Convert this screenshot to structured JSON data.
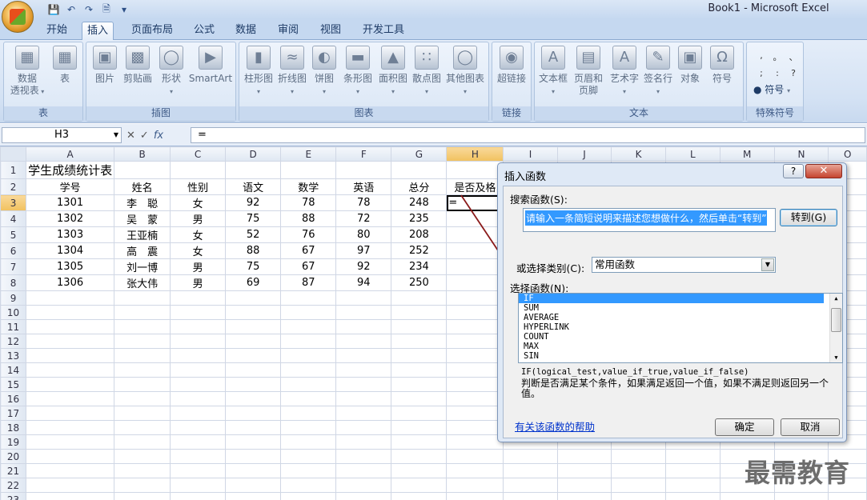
{
  "titlebar": {
    "window_title": "Book1 - Microsoft Excel"
  },
  "tabs": [
    {
      "label": "开始"
    },
    {
      "label": "插入"
    },
    {
      "label": "页面布局"
    },
    {
      "label": "公式"
    },
    {
      "label": "数据"
    },
    {
      "label": "审阅"
    },
    {
      "label": "视图"
    },
    {
      "label": "开发工具"
    }
  ],
  "ribbon": {
    "groups": [
      {
        "title": "表",
        "buttons": [
          "数据\n透视表",
          "表"
        ]
      },
      {
        "title": "插图",
        "buttons": [
          "图片",
          "剪贴画",
          "形状",
          "SmartArt"
        ]
      },
      {
        "title": "图表",
        "buttons": [
          "柱形图",
          "折线图",
          "饼图",
          "条形图",
          "面积图",
          "散点图",
          "其他图表"
        ]
      },
      {
        "title": "链接",
        "buttons": [
          "超链接"
        ]
      },
      {
        "title": "文本",
        "buttons": [
          "文本框",
          "页眉和\n页脚",
          "艺术字",
          "签名行",
          "对象",
          "符号"
        ]
      },
      {
        "title": "特殊符号",
        "buttons": [
          "符号"
        ]
      }
    ],
    "special_symbols": [
      ", ",
      "。",
      "、",
      ";",
      ":",
      "?"
    ]
  },
  "formula_bar": {
    "name_box": "H3",
    "formula": "="
  },
  "sheet": {
    "columns": [
      "A",
      "B",
      "C",
      "D",
      "E",
      "F",
      "G",
      "H",
      "I",
      "J",
      "K",
      "L",
      "M",
      "N",
      "O"
    ],
    "rows": [
      [
        "学生成绩统计表",
        "",
        "",
        "",
        "",
        "",
        "",
        "",
        ""
      ],
      [
        "学号",
        "姓名",
        "性别",
        "语文",
        "数学",
        "英语",
        "总分",
        "是否及格",
        ""
      ],
      [
        "1301",
        "李　聪",
        "女",
        "92",
        "78",
        "78",
        "248",
        "=",
        ""
      ],
      [
        "1302",
        "吴　蒙",
        "男",
        "75",
        "88",
        "72",
        "235",
        "",
        ""
      ],
      [
        "1303",
        "王亚楠",
        "女",
        "52",
        "76",
        "80",
        "208",
        "",
        ""
      ],
      [
        "1304",
        "高　震",
        "女",
        "88",
        "67",
        "97",
        "252",
        "",
        ""
      ],
      [
        "1305",
        "刘一博",
        "男",
        "75",
        "67",
        "92",
        "234",
        "",
        ""
      ],
      [
        "1306",
        "张大伟",
        "男",
        "69",
        "87",
        "94",
        "250",
        "",
        ""
      ]
    ],
    "row_count": 23
  },
  "dialog": {
    "title": "插入函数",
    "search_label": "搜索函数(S):",
    "search_value": "请输入一条简短说明来描述您想做什么，然后单击“转到”",
    "go_button": "转到(G)",
    "category_label": "或选择类别(C):",
    "category_value": "常用函数",
    "select_label": "选择函数(N):",
    "functions": [
      "IF",
      "SUM",
      "AVERAGE",
      "HYPERLINK",
      "COUNT",
      "MAX",
      "SIN"
    ],
    "selected_function": "IF",
    "signature": "IF(logical_test,value_if_true,value_if_false)",
    "description": "判断是否满足某个条件，如果满足返回一个值，如果不满足则返回另一个值。",
    "help_link": "有关该函数的帮助",
    "ok_button": "确定",
    "cancel_button": "取消"
  },
  "watermark": "最需教育"
}
